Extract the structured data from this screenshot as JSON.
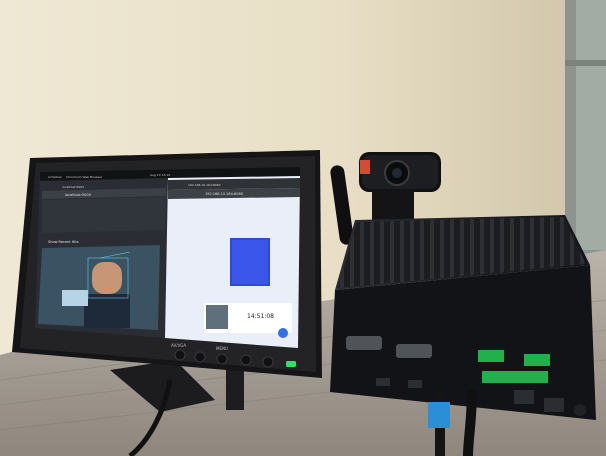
{
  "monitor": {
    "buttons": [
      "AV/VGA",
      "MENU"
    ],
    "power_led_color": "#29e36b"
  },
  "screen": {
    "topbar": {
      "activities": "Activities",
      "app": "Chromium Web Browser",
      "clock": "Aug 14  13:10"
    },
    "left_window": {
      "tab": "localhost:5000",
      "address": "localhost:5000",
      "section": "Show Recent Hits"
    },
    "right_window": {
      "tab": "192.168.10.164:8080",
      "address": "192.168.10.164:8080",
      "event_time": "14:51:08"
    },
    "accent_color": "#2f6fe8"
  },
  "pc": {
    "brand_color": "#1a1a1d",
    "port_color_green": "#22b04a",
    "cable_color": "#2b8fd8"
  }
}
